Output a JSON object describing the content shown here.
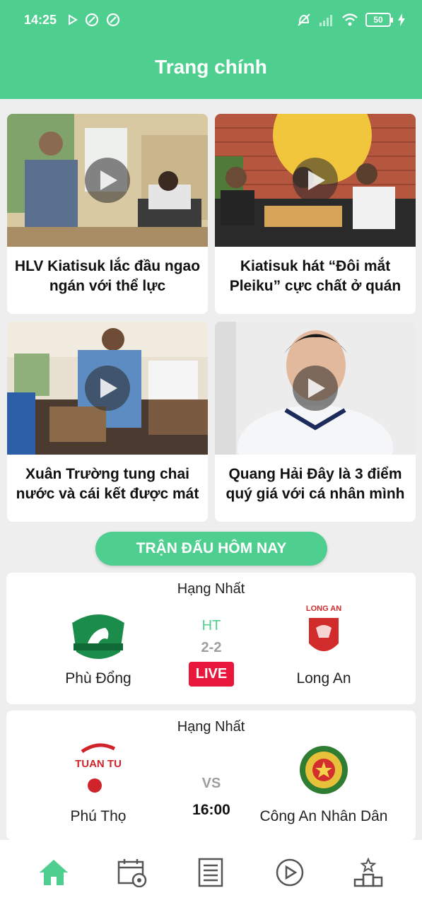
{
  "status": {
    "time": "14:25",
    "battery": "50"
  },
  "header": {
    "title": "Trang chính"
  },
  "videos": [
    {
      "title": "HLV Kiatisuk lắc đầu ngao ngán với thể lực"
    },
    {
      "title": "Kiatisuk hát “Đôi mắt Pleiku” cực chất ở quán"
    },
    {
      "title": "Xuân Trường tung chai nước và cái kết được mát"
    },
    {
      "title": "Quang Hải Đây là 3 điểm quý giá với cá nhân mình"
    }
  ],
  "section": {
    "label": "TRẬN ĐẤU HÔM NAY"
  },
  "matches": [
    {
      "league": "Hạng Nhất",
      "home": "Phù Đổng",
      "away": "Long An",
      "status": "HT",
      "score": "2-2",
      "badge": "LIVE"
    },
    {
      "league": "Hạng Nhất",
      "home": "Phú Thọ",
      "away": "Công An Nhân Dân",
      "status": "VS",
      "time": "16:00"
    }
  ],
  "logos": {
    "long_an": "LONG AN",
    "tuan_tu": "TUAN TU"
  },
  "colors": {
    "accent": "#4fcf8f",
    "live": "#e8173b"
  },
  "nav": [
    "home-icon",
    "calendar-ball-icon",
    "news-icon",
    "play-circle-icon",
    "podium-icon"
  ]
}
